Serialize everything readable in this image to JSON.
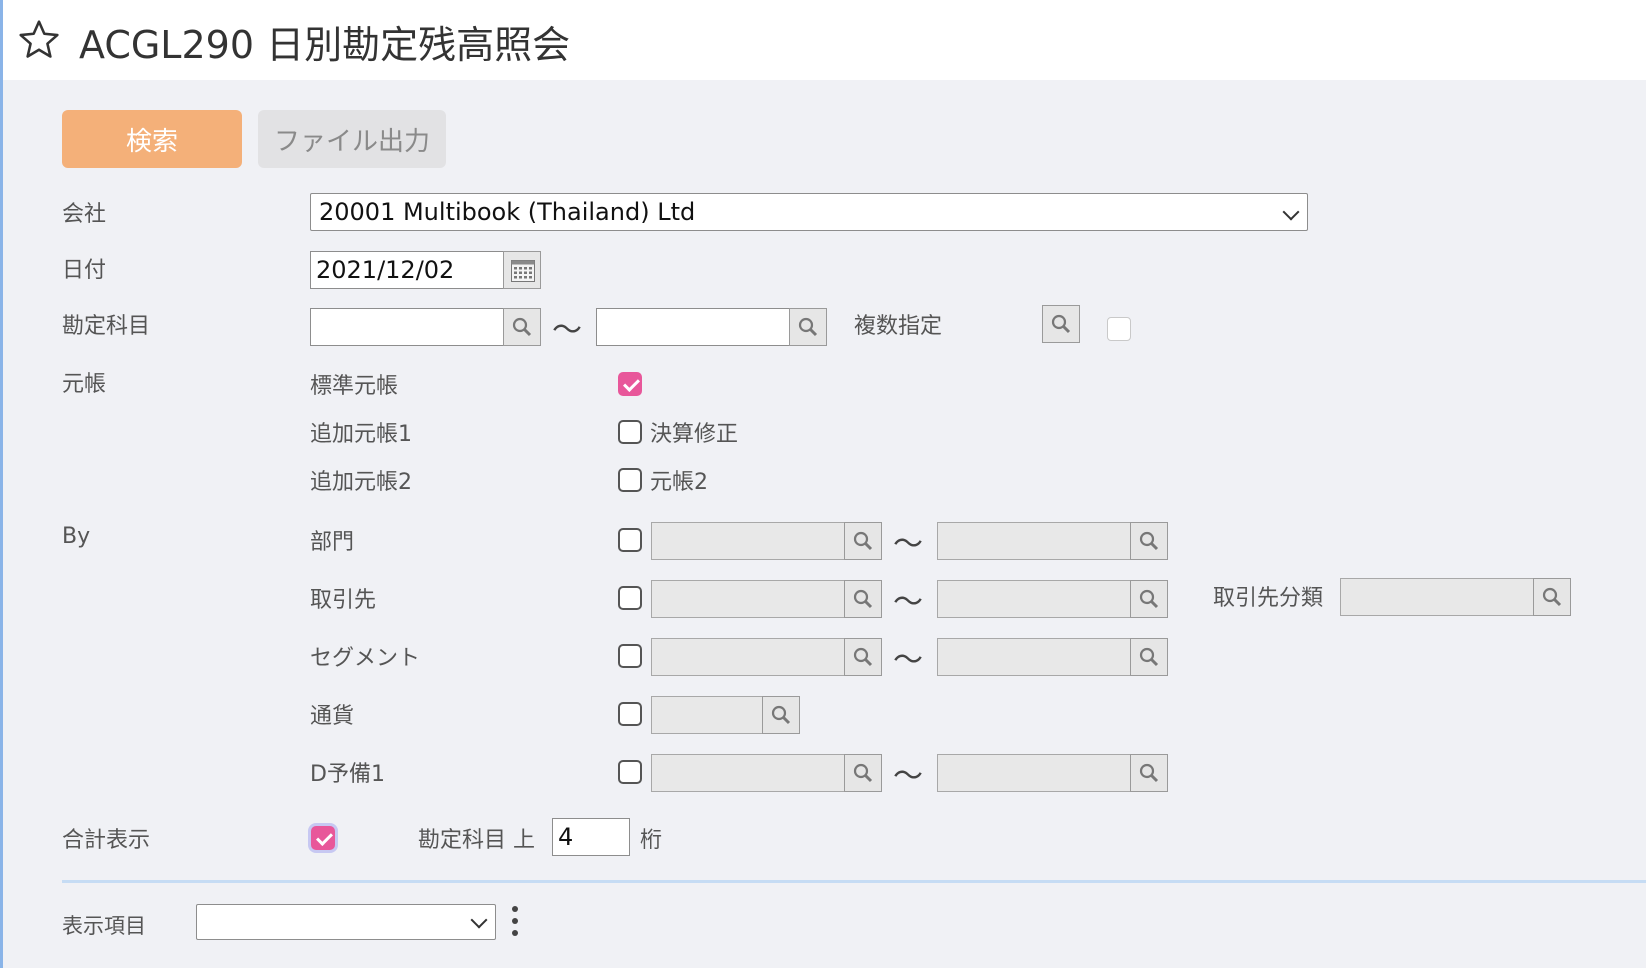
{
  "header": {
    "title": "ACGL290 日別勘定残高照会"
  },
  "toolbar": {
    "search_label": "検索",
    "file_output_label": "ファイル出力"
  },
  "form": {
    "company": {
      "label": "会社",
      "value": "20001 Multibook (Thailand) Ltd"
    },
    "date": {
      "label": "日付",
      "value": "2021/12/02"
    },
    "account": {
      "label": "勘定科目",
      "tilde": "～",
      "multiple_label": "複数指定"
    },
    "ledger": {
      "label": "元帳",
      "items": [
        {
          "label": "標準元帳",
          "checked": true
        },
        {
          "label": "追加元帳1",
          "checkbox_label": "決算修正",
          "checked": false
        },
        {
          "label": "追加元帳2",
          "checkbox_label": "元帳2",
          "checked": false
        }
      ]
    },
    "by": {
      "label": "By",
      "rows": [
        {
          "label": "部門"
        },
        {
          "label": "取引先",
          "extra_label": "取引先分類"
        },
        {
          "label": "セグメント"
        },
        {
          "label": "通貨"
        },
        {
          "label": "D予備1"
        }
      ]
    },
    "total": {
      "label": "合計表示",
      "checked": true,
      "account_label": "勘定科目 上",
      "digits": "4",
      "unit": "桁"
    }
  },
  "display": {
    "label": "表示項目",
    "value": ""
  }
}
